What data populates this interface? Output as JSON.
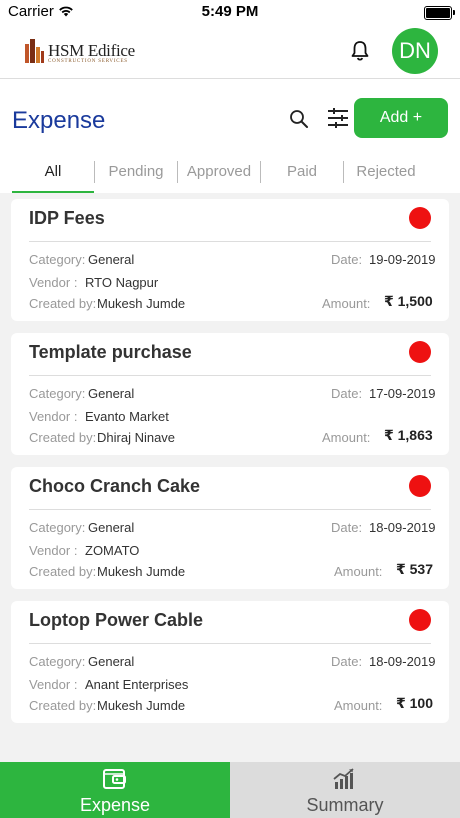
{
  "status_bar": {
    "carrier": "Carrier",
    "time": "5:49 PM"
  },
  "header": {
    "brand_name": "HSM Edifice",
    "brand_tagline": "CONSTRUCTION SERVICES",
    "avatar_initials": "DN"
  },
  "page": {
    "title": "Expense",
    "add_label": "Add +"
  },
  "tabs": [
    {
      "label": "All",
      "active": true
    },
    {
      "label": "Pending",
      "active": false
    },
    {
      "label": "Approved",
      "active": false
    },
    {
      "label": "Paid",
      "active": false
    },
    {
      "label": "Rejected",
      "active": false
    }
  ],
  "labels": {
    "category": "Category:",
    "vendor": "Vendor :",
    "created_by": "Created by:",
    "date": "Date:",
    "amount": "Amount:"
  },
  "expenses": [
    {
      "name": "IDP Fees",
      "category": "General",
      "vendor": "RTO Nagpur",
      "created_by": "Mukesh Jumde",
      "date": "19-09-2019",
      "amount": "₹ 1,500",
      "status_color": "#ee1111"
    },
    {
      "name": "Template purchase",
      "category": "General",
      "vendor": "Evanto Market",
      "created_by": "Dhiraj Ninave",
      "date": "17-09-2019",
      "amount": "₹ 1,863",
      "status_color": "#ee1111"
    },
    {
      "name": "Choco Cranch Cake",
      "category": "General",
      "vendor": "ZOMATO",
      "created_by": "Mukesh Jumde",
      "date": "18-09-2019",
      "amount": "₹ 537",
      "status_color": "#ee1111"
    },
    {
      "name": "Loptop Power Cable",
      "category": "General",
      "vendor": "Anant Enterprises",
      "created_by": "Mukesh Jumde",
      "date": "18-09-2019",
      "amount": "₹ 100",
      "status_color": "#ee1111"
    }
  ],
  "bottom_nav": [
    {
      "label": "Expense",
      "icon": "wallet-icon",
      "active": true
    },
    {
      "label": "Summary",
      "icon": "chart-icon",
      "active": false
    }
  ],
  "colors": {
    "accent": "#2db53f",
    "title": "#1a3a9c",
    "status_dot": "#ee1111"
  }
}
